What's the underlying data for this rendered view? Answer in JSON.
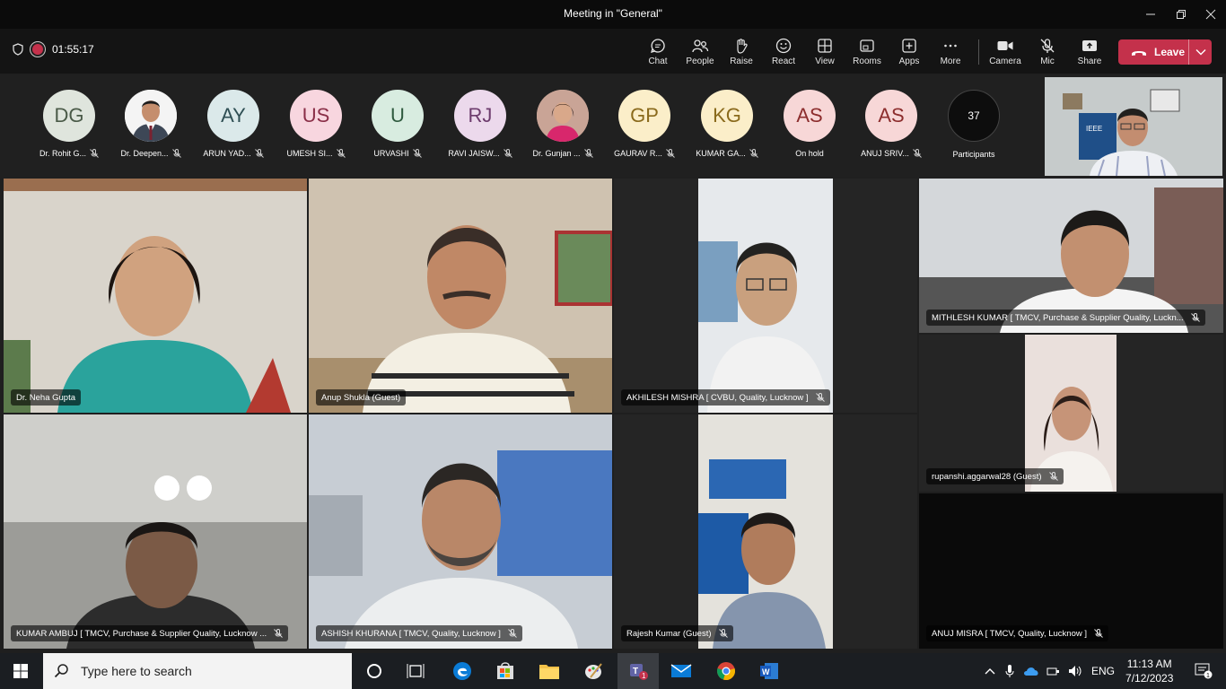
{
  "window": {
    "title": "Meeting in \"General\""
  },
  "toolbar": {
    "timer": "01:55:17",
    "buttons": [
      "Chat",
      "People",
      "Raise",
      "React",
      "View",
      "Rooms",
      "Apps",
      "More",
      "Camera",
      "Mic",
      "Share"
    ],
    "leave": "Leave",
    "leave_color": "#c4314b"
  },
  "strip": {
    "people": [
      {
        "initials": "DG",
        "name": "Dr. Rohit G...",
        "bg": "#dfe5dd",
        "fg": "#4a5a48"
      },
      {
        "initials": "",
        "name": "Dr. Deepen...",
        "bg": "#ffffff",
        "fg": "#333333",
        "photo": true
      },
      {
        "initials": "AY",
        "name": "ARUN YAD...",
        "bg": "#dbe9ea",
        "fg": "#2f4f54"
      },
      {
        "initials": "US",
        "name": "UMESH SI...",
        "bg": "#f8d6df",
        "fg": "#8a2f48"
      },
      {
        "initials": "U",
        "name": "URVASHI",
        "bg": "#d8ece0",
        "fg": "#2f5a3f"
      },
      {
        "initials": "RJ",
        "name": "RAVI JAISW...",
        "bg": "#ecd9ec",
        "fg": "#6d3c6d"
      },
      {
        "initials": "",
        "name": "Dr. Gunjan ...",
        "bg": "#d9b3a5",
        "fg": "#333333",
        "photo": true
      },
      {
        "initials": "GP",
        "name": "GAURAV R...",
        "bg": "#fbeec9",
        "fg": "#8a6a1c"
      },
      {
        "initials": "KG",
        "name": "KUMAR GA...",
        "bg": "#fbeec9",
        "fg": "#8a6a1c"
      },
      {
        "initials": "AS",
        "name": "On hold",
        "bg": "#f7d7d7",
        "fg": "#8c2d2d",
        "hold": true
      },
      {
        "initials": "AS",
        "name": "ANUJ SRIV...",
        "bg": "#f7d7d7",
        "fg": "#8c2d2d"
      }
    ],
    "participants_count": "37",
    "participants_label": "Participants"
  },
  "tiles": [
    {
      "name": "Dr. Neha Gupta",
      "mic": false
    },
    {
      "name": "Anup Shukla (Guest)",
      "mic": false
    },
    {
      "name": "AKHILESH MISHRA [ CVBU, Quality, Lucknow ]",
      "mic": true
    },
    {
      "name": "MITHLESH KUMAR [ TMCV, Purchase & Supplier Quality, Luckn...",
      "mic": true
    },
    {
      "name": "rupanshi.aggarwal28 (Guest)",
      "mic": true
    },
    {
      "name": "KUMAR AMBUJ [ TMCV, Purchase & Supplier Quality, Lucknow ...",
      "mic": true
    },
    {
      "name": "ASHISH KHURANA [ TMCV, Quality, Lucknow ]",
      "mic": true
    },
    {
      "name": "Rajesh Kumar (Guest)",
      "mic": true
    },
    {
      "name": "ANUJ MISRA [ TMCV, Quality, Lucknow ]",
      "mic": true
    }
  ],
  "taskbar": {
    "search_placeholder": "Type here to search",
    "lang": "ENG",
    "time": "11:13 AM",
    "date": "7/12/2023",
    "teams_badge": "1",
    "notif_badge": "1"
  },
  "colors": {
    "accent": "#c4314b",
    "teams": "#6264a7",
    "edge": "#0a7bd6"
  }
}
